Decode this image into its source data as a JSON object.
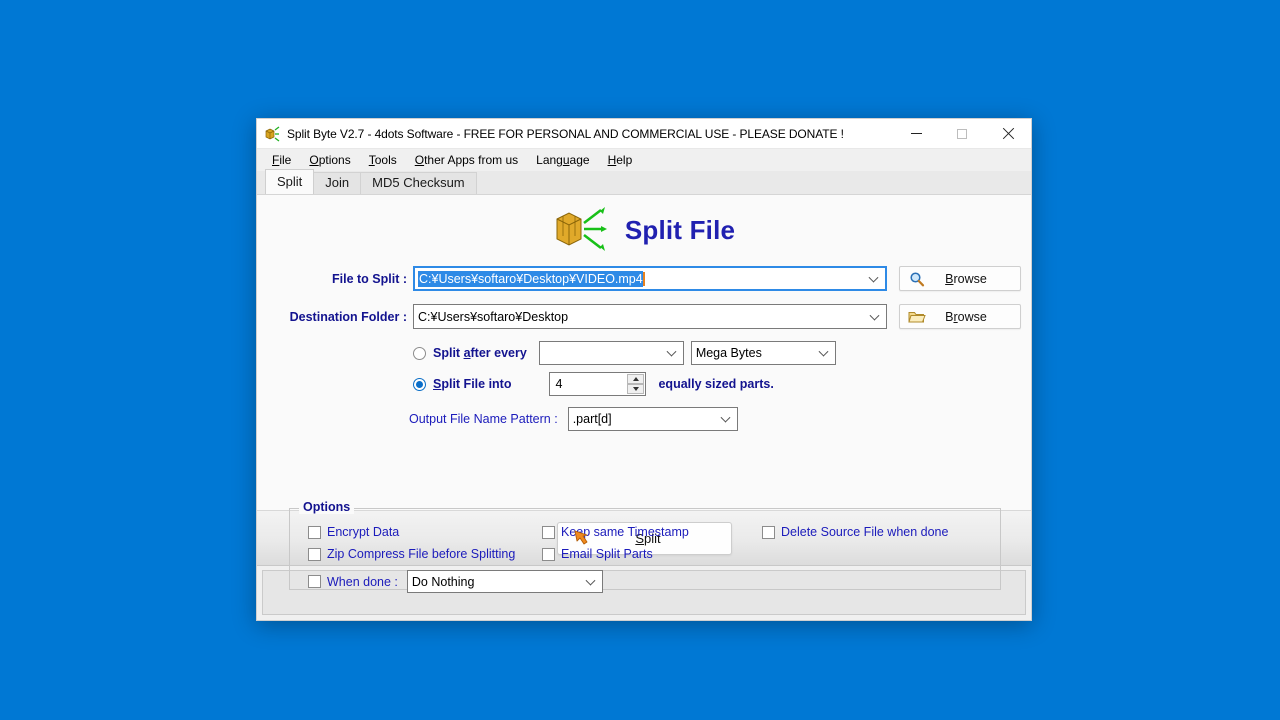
{
  "desktop": {
    "background_color": "#0078d4"
  },
  "window": {
    "title": "Split Byte V2.7 - 4dots Software - FREE FOR PERSONAL AND COMMERCIAL USE - PLEASE DONATE !",
    "app_icon": "split-box-icon",
    "controls": {
      "minimize": "minimize-icon",
      "maximize": "maximize-icon",
      "close": "close-icon"
    }
  },
  "menubar": {
    "items": [
      {
        "label": "File",
        "accel": "F"
      },
      {
        "label": "Options",
        "accel": "O"
      },
      {
        "label": "Tools",
        "accel": "T"
      },
      {
        "label": "Other Apps from us",
        "accel": "O"
      },
      {
        "label": "Language",
        "accel": "L"
      },
      {
        "label": "Help",
        "accel": "H"
      }
    ]
  },
  "tabs": [
    {
      "label": "Split",
      "active": true
    },
    {
      "label": "Join",
      "active": false
    },
    {
      "label": "MD5 Checksum",
      "active": false
    }
  ],
  "header": {
    "logo_icon": "split-box-arrows-icon",
    "heading": "Split File",
    "heading_color": "#2020b0"
  },
  "form": {
    "file_to_split": {
      "label": "File to Split :",
      "value": "C:¥Users¥softaro¥Desktop¥VIDEO.mp4",
      "selected": true,
      "focused": true,
      "selection_color": "#2e8ae6",
      "browse_label": "Browse",
      "browse_accel": "B",
      "browse_icon": "magnifier-icon"
    },
    "destination_folder": {
      "label": "Destination Folder :",
      "value": "C:¥Users¥softaro¥Desktop",
      "browse_label": "Browse",
      "browse_accel": "r",
      "browse_icon": "folder-icon"
    },
    "split_after_every": {
      "label": "Split after every",
      "accel": "a",
      "selected": false,
      "size_value": "",
      "unit_value": "Mega Bytes"
    },
    "split_file_into": {
      "label": "Split File into",
      "accel": "S",
      "selected": true,
      "parts_value": "4",
      "suffix_label": "equally sized parts."
    },
    "output_pattern": {
      "label": "Output File Name Pattern :",
      "value": ".part[d]"
    }
  },
  "options": {
    "legend": "Options",
    "checkboxes": [
      {
        "label": "Encrypt Data",
        "checked": false
      },
      {
        "label": "Keep same Timestamp",
        "checked": false
      },
      {
        "label": "Delete Source File when done",
        "checked": false
      },
      {
        "label": "Zip Compress File before Splitting",
        "checked": false
      },
      {
        "label": "Email Split Parts",
        "checked": false
      }
    ],
    "when_done": {
      "label": "When done :",
      "checked": false,
      "value": "Do Nothing"
    }
  },
  "action": {
    "split_label": "Split",
    "split_accel": "p",
    "split_icon": "orange-arrow-icon"
  },
  "status": {
    "text": ""
  }
}
